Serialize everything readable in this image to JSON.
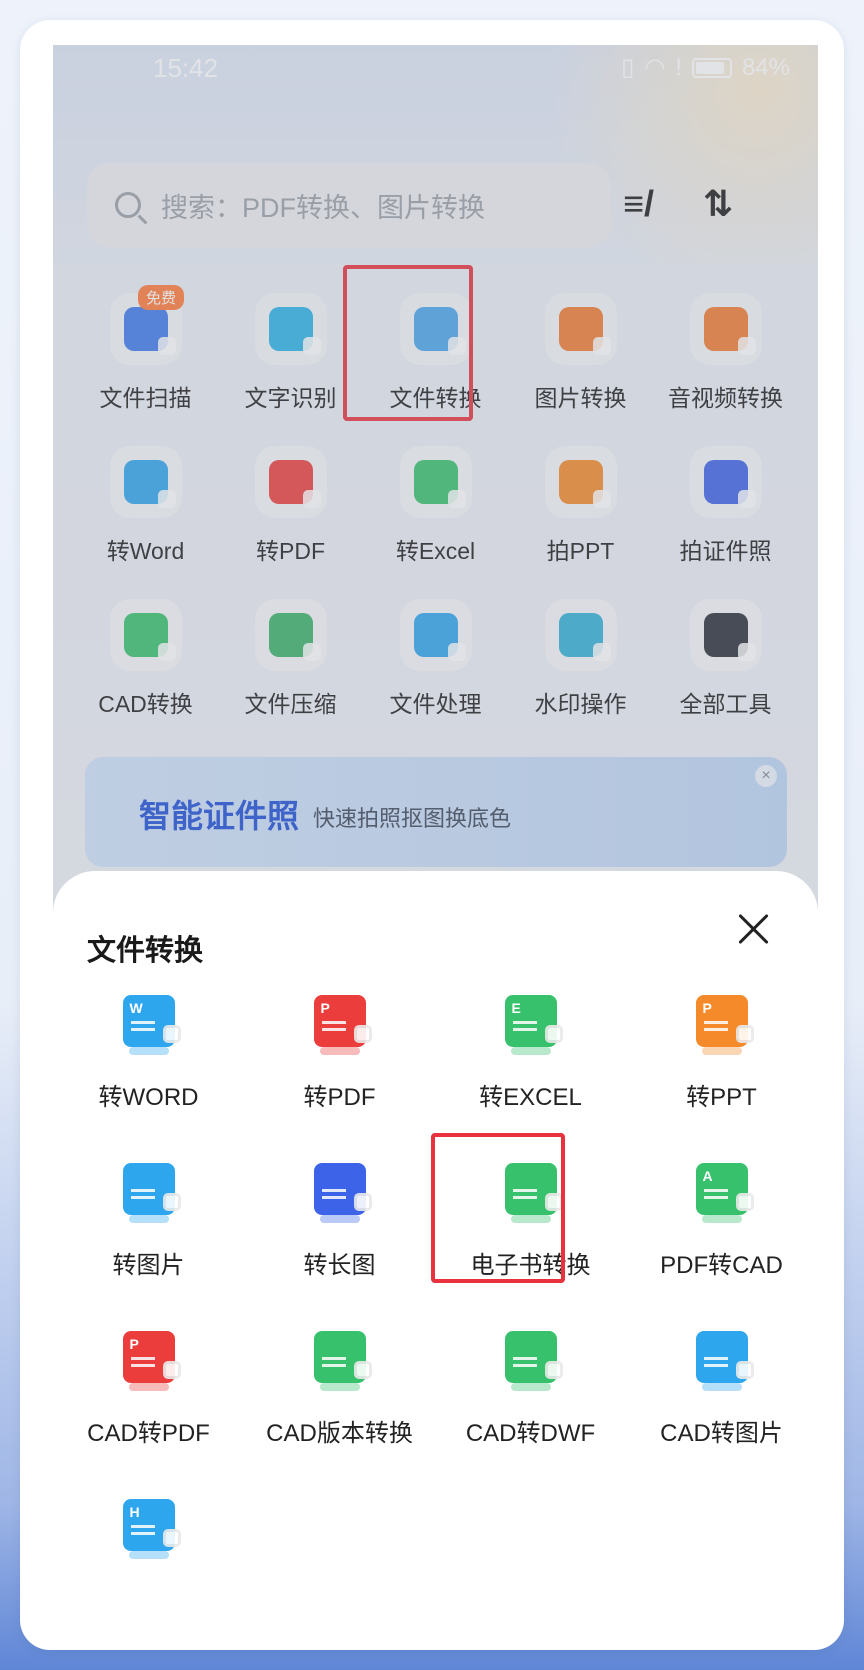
{
  "status_bar": {
    "time": "15:42",
    "battery": "84%"
  },
  "search": {
    "placeholder": "搜索：PDF转换、图片转换"
  },
  "tools": [
    {
      "label": "文件扫描",
      "icon": "scan-icon",
      "color": "#3d7bea"
    },
    {
      "label": "文字识别",
      "icon": "text-recognition-icon",
      "color": "#2bb3e8"
    },
    {
      "label": "文件转换",
      "icon": "file-convert-icon",
      "color": "#4aa5ea"
    },
    {
      "label": "图片转换",
      "icon": "image-convert-icon",
      "color": "#f07a32"
    },
    {
      "label": "音视频转换",
      "icon": "media-convert-icon",
      "color": "#f07a32"
    },
    {
      "label": "转Word",
      "icon": "word-icon",
      "color": "#2ea6ee"
    },
    {
      "label": "转PDF",
      "icon": "pdf-icon",
      "color": "#ec3d3d"
    },
    {
      "label": "转Excel",
      "icon": "excel-icon",
      "color": "#37c16c"
    },
    {
      "label": "拍PPT",
      "icon": "ppt-icon",
      "color": "#f48a2a"
    },
    {
      "label": "拍证件照",
      "icon": "id-photo-icon",
      "color": "#3d63e8"
    },
    {
      "label": "CAD转换",
      "icon": "cad-icon",
      "color": "#37c16c"
    },
    {
      "label": "文件压缩",
      "icon": "compress-icon",
      "color": "#3bb26a"
    },
    {
      "label": "文件处理",
      "icon": "file-process-icon",
      "color": "#2ea6ee"
    },
    {
      "label": "水印操作",
      "icon": "watermark-icon",
      "color": "#31b0d6"
    },
    {
      "label": "全部工具",
      "icon": "all-tools-icon",
      "color": "#2a2f3a"
    }
  ],
  "free_badge": "免费",
  "banner": {
    "title": "智能证件照",
    "subtitle": "快速拍照抠图换底色"
  },
  "sheet": {
    "title": "文件转换",
    "items": [
      {
        "label": "转WORD",
        "glyph": "W",
        "color": "#2ea6ee"
      },
      {
        "label": "转PDF",
        "glyph": "P",
        "color": "#ec3d3d"
      },
      {
        "label": "转EXCEL",
        "glyph": "E",
        "color": "#37c16c"
      },
      {
        "label": "转PPT",
        "glyph": "P",
        "color": "#f48a2a"
      },
      {
        "label": "转图片",
        "glyph": "",
        "color": "#2ea6ee"
      },
      {
        "label": "转长图",
        "glyph": "",
        "color": "#3d63e8"
      },
      {
        "label": "电子书转换",
        "glyph": "",
        "color": "#37c16c"
      },
      {
        "label": "PDF转CAD",
        "glyph": "A",
        "color": "#37c16c"
      },
      {
        "label": "CAD转PDF",
        "glyph": "P",
        "color": "#ec3d3d"
      },
      {
        "label": "CAD版本转换",
        "glyph": "",
        "color": "#37c16c"
      },
      {
        "label": "CAD转DWF",
        "glyph": "",
        "color": "#37c16c"
      },
      {
        "label": "CAD转图片",
        "glyph": "",
        "color": "#2ea6ee"
      },
      {
        "label": "",
        "glyph": "H",
        "color": "#2ea6ee"
      }
    ]
  }
}
